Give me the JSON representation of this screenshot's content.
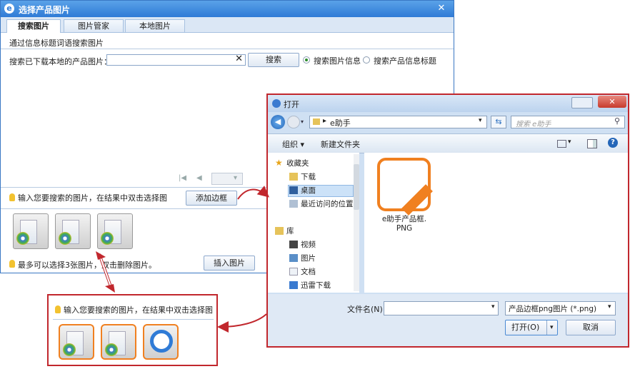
{
  "main_window": {
    "title": "选择产品图片",
    "tabs": [
      {
        "label": "搜索图片",
        "active": true
      },
      {
        "label": "图片管家",
        "active": false
      },
      {
        "label": "本地图片",
        "active": false
      }
    ],
    "hint": "通过信息标题词语搜索图片",
    "search_label": "搜索已下载本地的产品图片：",
    "search_value": "",
    "clear_glyph": "✕",
    "search_button": "搜索",
    "radio_options": [
      {
        "label": "搜索图片信息",
        "selected": true
      },
      {
        "label": "搜索产品信息标题",
        "selected": false
      }
    ],
    "tip_text": "输入您要搜索的图片，在结果中双击选择图",
    "add_frame_button": "添加边框",
    "bottom_note": "最多可以选择3张图片，双击删除图片。",
    "insert_button": "插入图片"
  },
  "open_dialog": {
    "title": "打开",
    "address_path": "e助手",
    "search_placeholder": "搜索 e助手",
    "toolbar": {
      "organize": "组织 ▾",
      "new_folder": "新建文件夹"
    },
    "nav": {
      "favorites_label": "收藏夹",
      "favorites": [
        "下载",
        "桌面",
        "最近访问的位置"
      ],
      "library_label": "库",
      "libraries": [
        "视频",
        "图片",
        "文档",
        "迅雷下载"
      ],
      "selected": "桌面"
    },
    "file": {
      "name_line1": "e助手产品框.",
      "name_line2": "PNG"
    },
    "filename_label": "文件名(N):",
    "filename_value": "",
    "filter": "产品边框png图片 (*.png)",
    "open_button": "打开(O)",
    "cancel_button": "取消"
  },
  "zoom_panel": {
    "tip_text": "输入您要搜索的图片，在结果中双击选择图"
  },
  "colors": {
    "accent_red": "#c1272d",
    "title_blue": "#2f7bd6",
    "frame_orange": "#f08020"
  }
}
